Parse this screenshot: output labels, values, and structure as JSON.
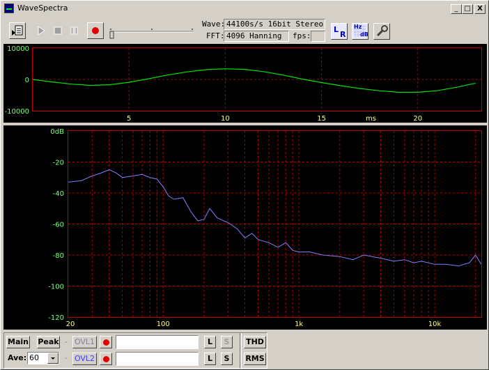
{
  "window": {
    "title": "WaveSpectra",
    "btn_min": "_",
    "btn_max": "□",
    "btn_close": "X"
  },
  "toolbar": {
    "wave_label": "Wave:",
    "wave_value": "44100s/s 16bit Stereo",
    "fft_label": "FFT:",
    "fft_value": "4096 Hanning",
    "fps_label": "fps:",
    "fps_value": "",
    "lr_label_l": "L",
    "lr_label_r": "R",
    "hz_label": "Hz",
    "db_label": "dB"
  },
  "wave_plot": {
    "y_ticks": [
      "10000",
      "0",
      "-10000"
    ],
    "x_ticks": [
      "5",
      "10",
      "15",
      "20"
    ],
    "unit": "ms",
    "trace_color": "#00e000"
  },
  "spectrum_plot": {
    "y_ticks": [
      "0dB",
      "-20",
      "-40",
      "-60",
      "-80",
      "-100",
      "-120"
    ],
    "x_ticks": [
      "20",
      "100",
      "1k",
      "10k"
    ],
    "trace_color": "#8080ff"
  },
  "bottom": {
    "main": "Main",
    "peak": "Peak",
    "dash1": "-",
    "ovl1": "OVL1",
    "ave_label": "Ave:",
    "ave_value": "60",
    "dash2": "-",
    "ovl2": "OVL2",
    "l1": "L",
    "s1": "S",
    "l2": "L",
    "s2": "S",
    "thd": "THD",
    "rms": "RMS"
  },
  "chart_data": [
    {
      "type": "line",
      "x": [
        0,
        1,
        2,
        3,
        4,
        5,
        6,
        7,
        8,
        9,
        10,
        11,
        12,
        13,
        14,
        15,
        16,
        17,
        18,
        19,
        20,
        21,
        22,
        23
      ],
      "series": [
        {
          "values": [
            0,
            -800,
            -1500,
            -1900,
            -1700,
            -900,
            200,
            1400,
            2400,
            3100,
            3400,
            3200,
            2500,
            1400,
            100,
            -1000,
            -2000,
            -2900,
            -3600,
            -4100,
            -4100,
            -3600,
            -2500,
            -1200
          ]
        }
      ],
      "xlim": [
        0,
        23.3
      ],
      "ylim": [
        -10000,
        10000
      ],
      "grid": true
    },
    {
      "type": "line",
      "x": [
        20,
        25,
        30,
        35,
        40,
        45,
        50,
        60,
        70,
        80,
        90,
        100,
        110,
        120,
        140,
        160,
        180,
        200,
        220,
        250,
        280,
        300,
        350,
        400,
        450,
        500,
        600,
        700,
        800,
        900,
        1000,
        1200,
        1500,
        2000,
        2500,
        3000,
        4000,
        5000,
        6000,
        7000,
        8000,
        10000,
        12000,
        15000,
        18000,
        20000,
        22000
      ],
      "series": [
        {
          "values": [
            -33,
            -32,
            -29,
            -27,
            -25,
            -27,
            -30,
            -29,
            -28,
            -30,
            -31,
            -36,
            -42,
            -44,
            -43,
            -52,
            -58,
            -57,
            -50,
            -56,
            -58,
            -59,
            -63,
            -69,
            -66,
            -70,
            -72,
            -75,
            -72,
            -77,
            -78,
            -78,
            -80,
            -81,
            -83,
            -80,
            -82,
            -84,
            -83,
            -85,
            -84,
            -86,
            -86,
            -87,
            -85,
            -80,
            -86
          ]
        }
      ],
      "xscale": "log",
      "xlim": [
        20,
        22050
      ],
      "ylim": [
        -120,
        0
      ],
      "grid": true
    }
  ]
}
